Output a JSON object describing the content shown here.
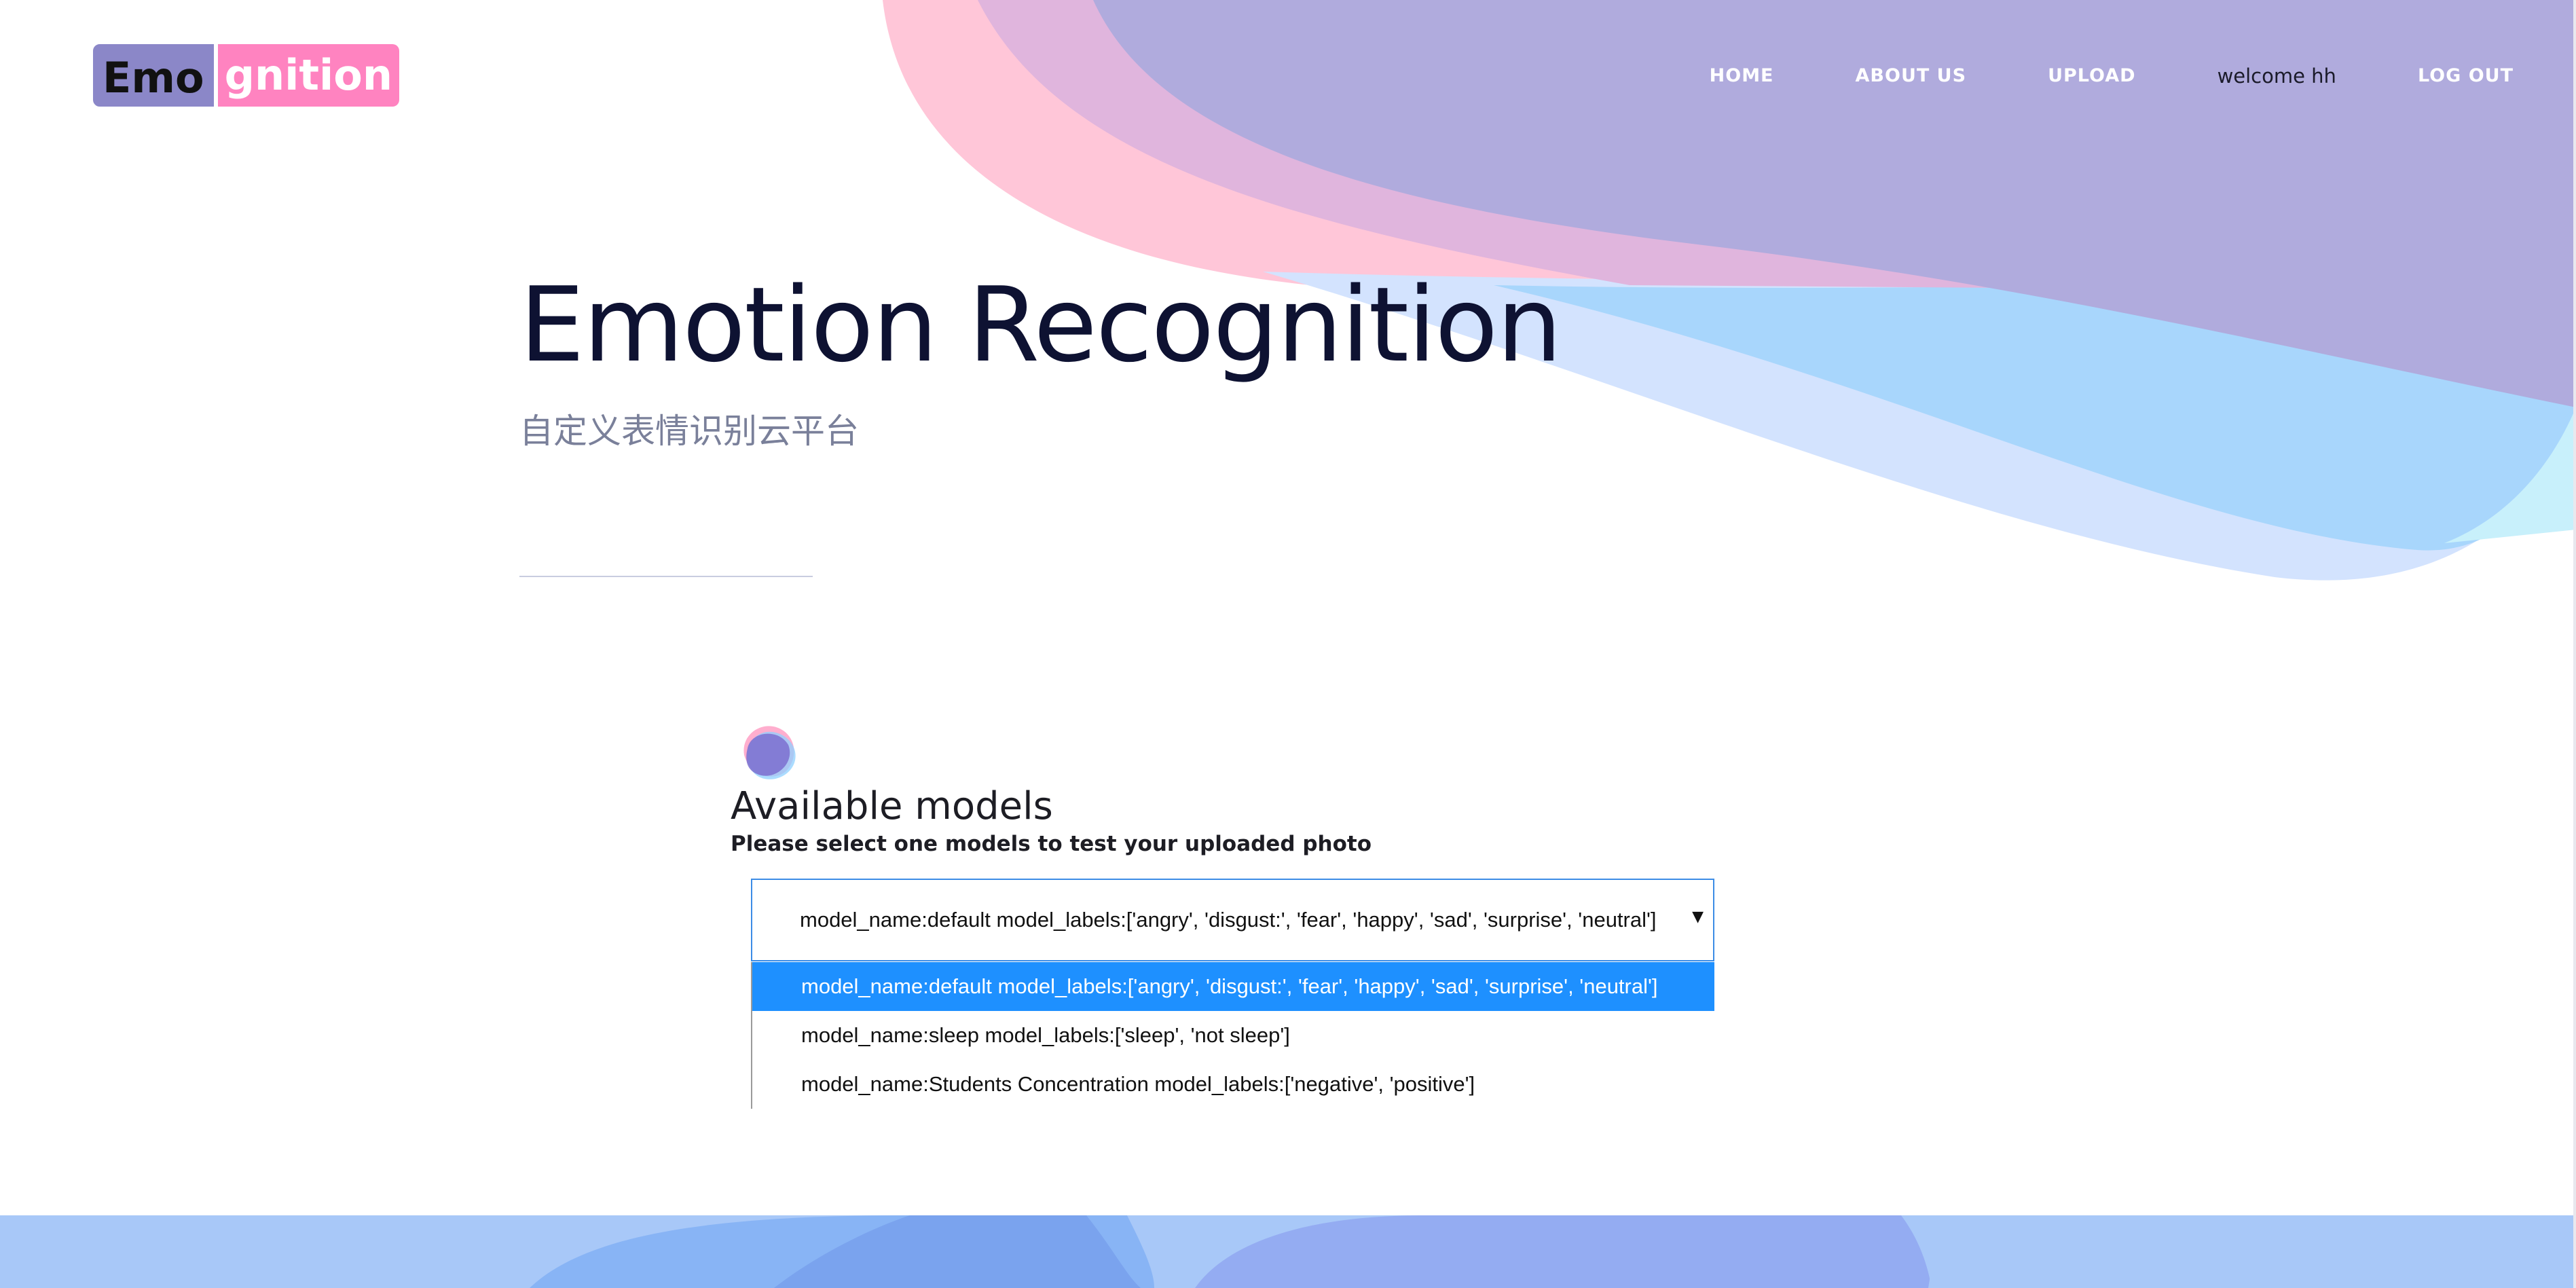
{
  "brand": {
    "logo_part1": "Emo",
    "logo_part2": "gnition"
  },
  "nav": {
    "home": "HOME",
    "about": "ABOUT US",
    "upload": "UPLOAD",
    "welcome": "welcome hh",
    "logout": "LOG OUT"
  },
  "hero": {
    "title": "Emotion Recognition",
    "subtitle": "自定义表情识别云平台"
  },
  "models": {
    "title": "Available models",
    "description": "Please select one models to test your uploaded photo",
    "selected": "model_name:default model_labels:['angry', 'disgust:', 'fear', 'happy', 'sad', 'surprise', 'neutral']",
    "options": [
      "model_name:default model_labels:['angry', 'disgust:', 'fear', 'happy', 'sad', 'surprise', 'neutral']",
      "model_name:sleep model_labels:['sleep', 'not sleep']",
      "model_name:Students Concentration model_labels:['negative', 'positive']"
    ]
  },
  "colors": {
    "accent_purple": "#8b87c8",
    "accent_pink": "#ff83c0",
    "select_highlight": "#1e90ff",
    "title_text": "#0e1232"
  },
  "icons": {
    "dropdown_arrow": "chevron-down-icon",
    "emblem": "blob-emblem-icon"
  }
}
